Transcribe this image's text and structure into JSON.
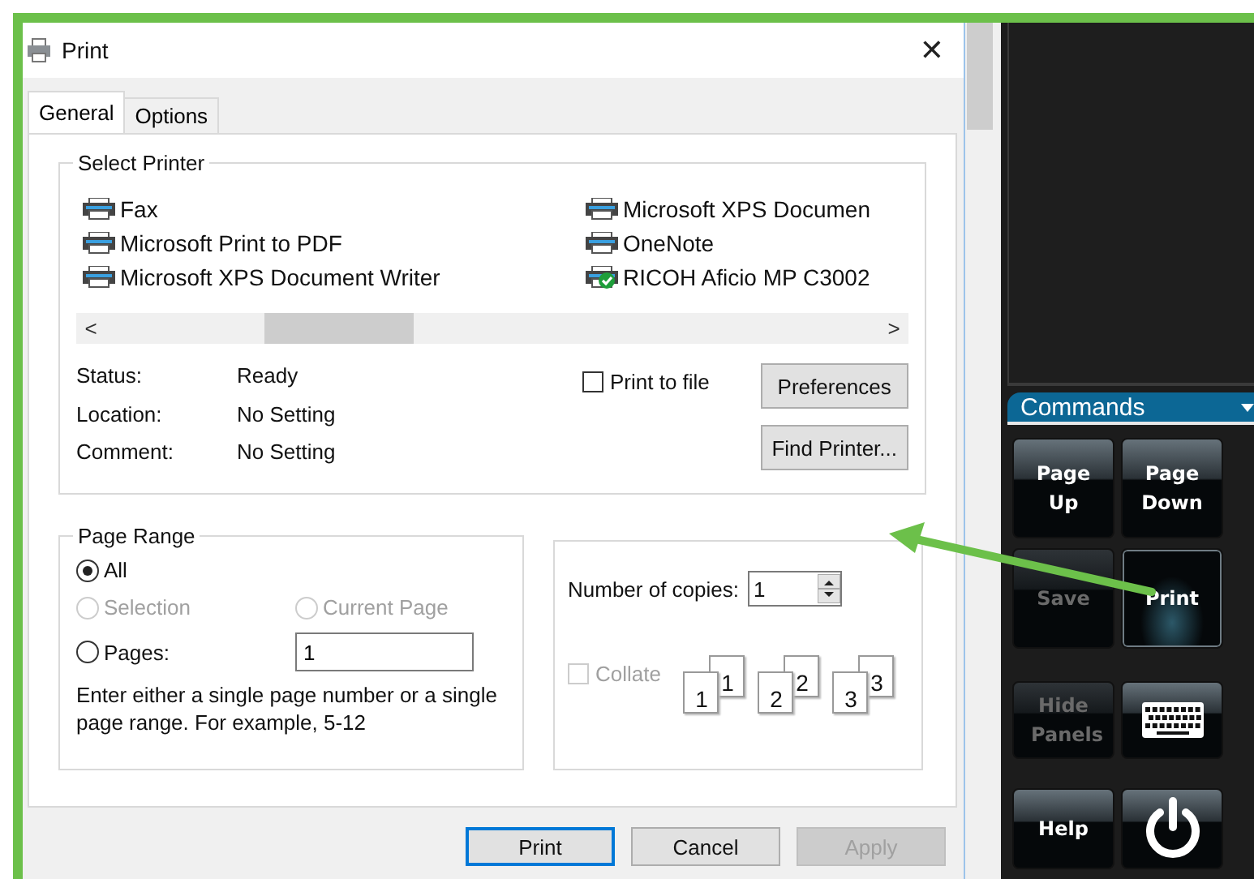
{
  "window": {
    "title": "Print",
    "close": "✕"
  },
  "tabs": [
    {
      "label": "General",
      "selected": true
    },
    {
      "label": "Options",
      "selected": false
    }
  ],
  "select_printer": {
    "title": "Select Printer",
    "printers": [
      {
        "name": "Fax",
        "default": false
      },
      {
        "name": "Microsoft Print to PDF",
        "default": false
      },
      {
        "name": "Microsoft XPS Document Writer",
        "default": false
      },
      {
        "name": "Microsoft XPS Documen",
        "default": false
      },
      {
        "name": "OneNote",
        "default": false
      },
      {
        "name": "RICOH Aficio MP C3002",
        "default": true
      }
    ],
    "scroll_left": "<",
    "scroll_right": ">",
    "info": [
      {
        "label": "Status:",
        "value": "Ready"
      },
      {
        "label": "Location:",
        "value": "No Setting"
      },
      {
        "label": "Comment:",
        "value": "No Setting"
      }
    ],
    "print_to_file": {
      "label": "Print to file",
      "checked": false
    },
    "buttons": [
      "Preferences",
      "Find Printer..."
    ]
  },
  "page_range": {
    "title": "Page Range",
    "options": [
      {
        "label": "All",
        "selected": true,
        "disabled": false
      },
      {
        "label": "Selection",
        "selected": false,
        "disabled": true
      },
      {
        "label": "Current Page",
        "selected": false,
        "disabled": true
      },
      {
        "label": "Pages:",
        "selected": false,
        "disabled": false
      }
    ],
    "pages_value": "1",
    "hint": "Enter either a single page number or a single page range.  For example, 5-12"
  },
  "copies": {
    "label": "Number of copies:",
    "value": "1",
    "collate": {
      "label": "Collate",
      "checked": false,
      "disabled": true
    },
    "collate_pages": [
      {
        "front": "1",
        "back": "1"
      },
      {
        "front": "2",
        "back": "2"
      },
      {
        "front": "3",
        "back": "3"
      }
    ]
  },
  "buttons": [
    {
      "label": "Print",
      "default": true,
      "disabled": false
    },
    {
      "label": "Cancel",
      "default": false,
      "disabled": false
    },
    {
      "label": "Apply",
      "default": false,
      "disabled": true
    }
  ],
  "commands": {
    "title": "Commands",
    "buttons": [
      {
        "kind": "text",
        "label": "Page Up",
        "disabled": false,
        "highlighted": false
      },
      {
        "kind": "text",
        "label": "Page Down",
        "disabled": false,
        "highlighted": false
      },
      {
        "kind": "text",
        "label": "Save",
        "disabled": true,
        "highlighted": false
      },
      {
        "kind": "text",
        "label": "Print",
        "disabled": false,
        "highlighted": true
      },
      {
        "kind": "text",
        "label": "Hide Panels",
        "disabled": true,
        "highlighted": false
      },
      {
        "kind": "keyboard",
        "disabled": false,
        "highlighted": false
      },
      {
        "kind": "text",
        "label": "Help",
        "disabled": false,
        "highlighted": false
      },
      {
        "kind": "power",
        "disabled": false,
        "highlighted": false
      }
    ]
  }
}
